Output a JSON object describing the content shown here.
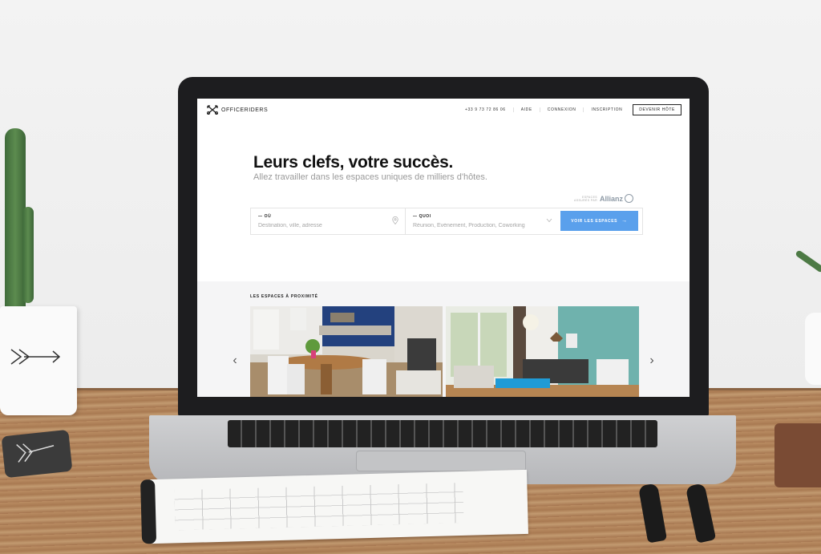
{
  "brand": {
    "name": "OFFICERIDERS"
  },
  "nav": {
    "phone": "+33 9 73 72 86 06",
    "help": "AIDE",
    "login": "CONNEXION",
    "signup": "INSCRIPTION",
    "become_host": "DEVENIR HÔTE"
  },
  "hero": {
    "title": "Leurs clefs, votre succès.",
    "subtitle": "Allez travailler dans les espaces uniques de milliers d'hôtes."
  },
  "insurance": {
    "line1": "ESPACES",
    "line2": "ASSURÉS PAR",
    "brand": "Allianz"
  },
  "search": {
    "where_label": "— OÙ",
    "where_placeholder": "Destination, ville, adresse",
    "what_label": "— QUOI",
    "what_placeholder": "Réunion, Événement, Production, Coworking",
    "submit_label": "VOIR LES ESPACES",
    "submit_arrow": "→"
  },
  "nearby": {
    "title": "LES ESPACES À PROXIMITÉ",
    "prev": "‹",
    "next": "›"
  },
  "icons": {
    "logo": "crossed-arrows-logo-icon",
    "location": "location-pin-icon",
    "dropdown": "chevron-down-icon"
  },
  "colors": {
    "accent": "#5aa0ec",
    "text": "#111111",
    "muted": "#9a9a9a"
  }
}
